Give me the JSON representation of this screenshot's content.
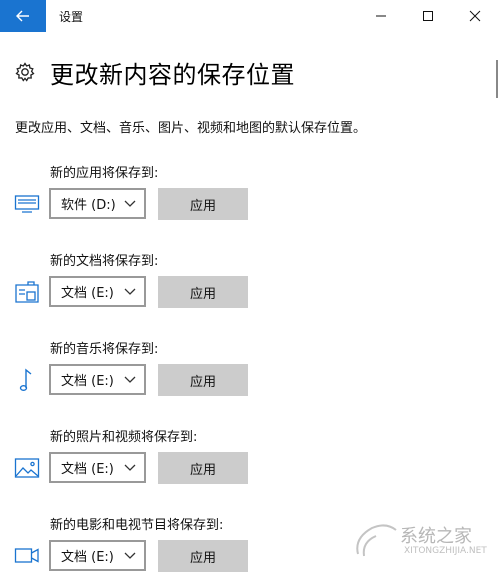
{
  "window": {
    "title": "设置"
  },
  "header": {
    "title": "更改新内容的保存位置",
    "description": "更改应用、文档、音乐、图片、视频和地图的默认保存位置。"
  },
  "sections": [
    {
      "label": "新的应用将保存到:",
      "icon": "monitor-icon",
      "drive": "软件 (D:)",
      "apply_label": "应用"
    },
    {
      "label": "新的文档将保存到:",
      "icon": "document-drive-icon",
      "drive": "文档 (E:)",
      "apply_label": "应用"
    },
    {
      "label": "新的音乐将保存到:",
      "icon": "music-note-icon",
      "drive": "文档 (E:)",
      "apply_label": "应用"
    },
    {
      "label": "新的照片和视频将保存到:",
      "icon": "picture-icon",
      "drive": "文档 (E:)",
      "apply_label": "应用"
    },
    {
      "label": "新的电影和电视节目将保存到:",
      "icon": "video-camera-icon",
      "drive": "文档 (E:)",
      "apply_label": "应用"
    }
  ],
  "watermark": {
    "text": "系统之家",
    "url": "XITONGZHIJIA.NET"
  },
  "colors": {
    "accent": "#1a74d0",
    "icon_blue": "#1a74d0",
    "button_bg": "#cccccc",
    "select_border": "#999999"
  }
}
